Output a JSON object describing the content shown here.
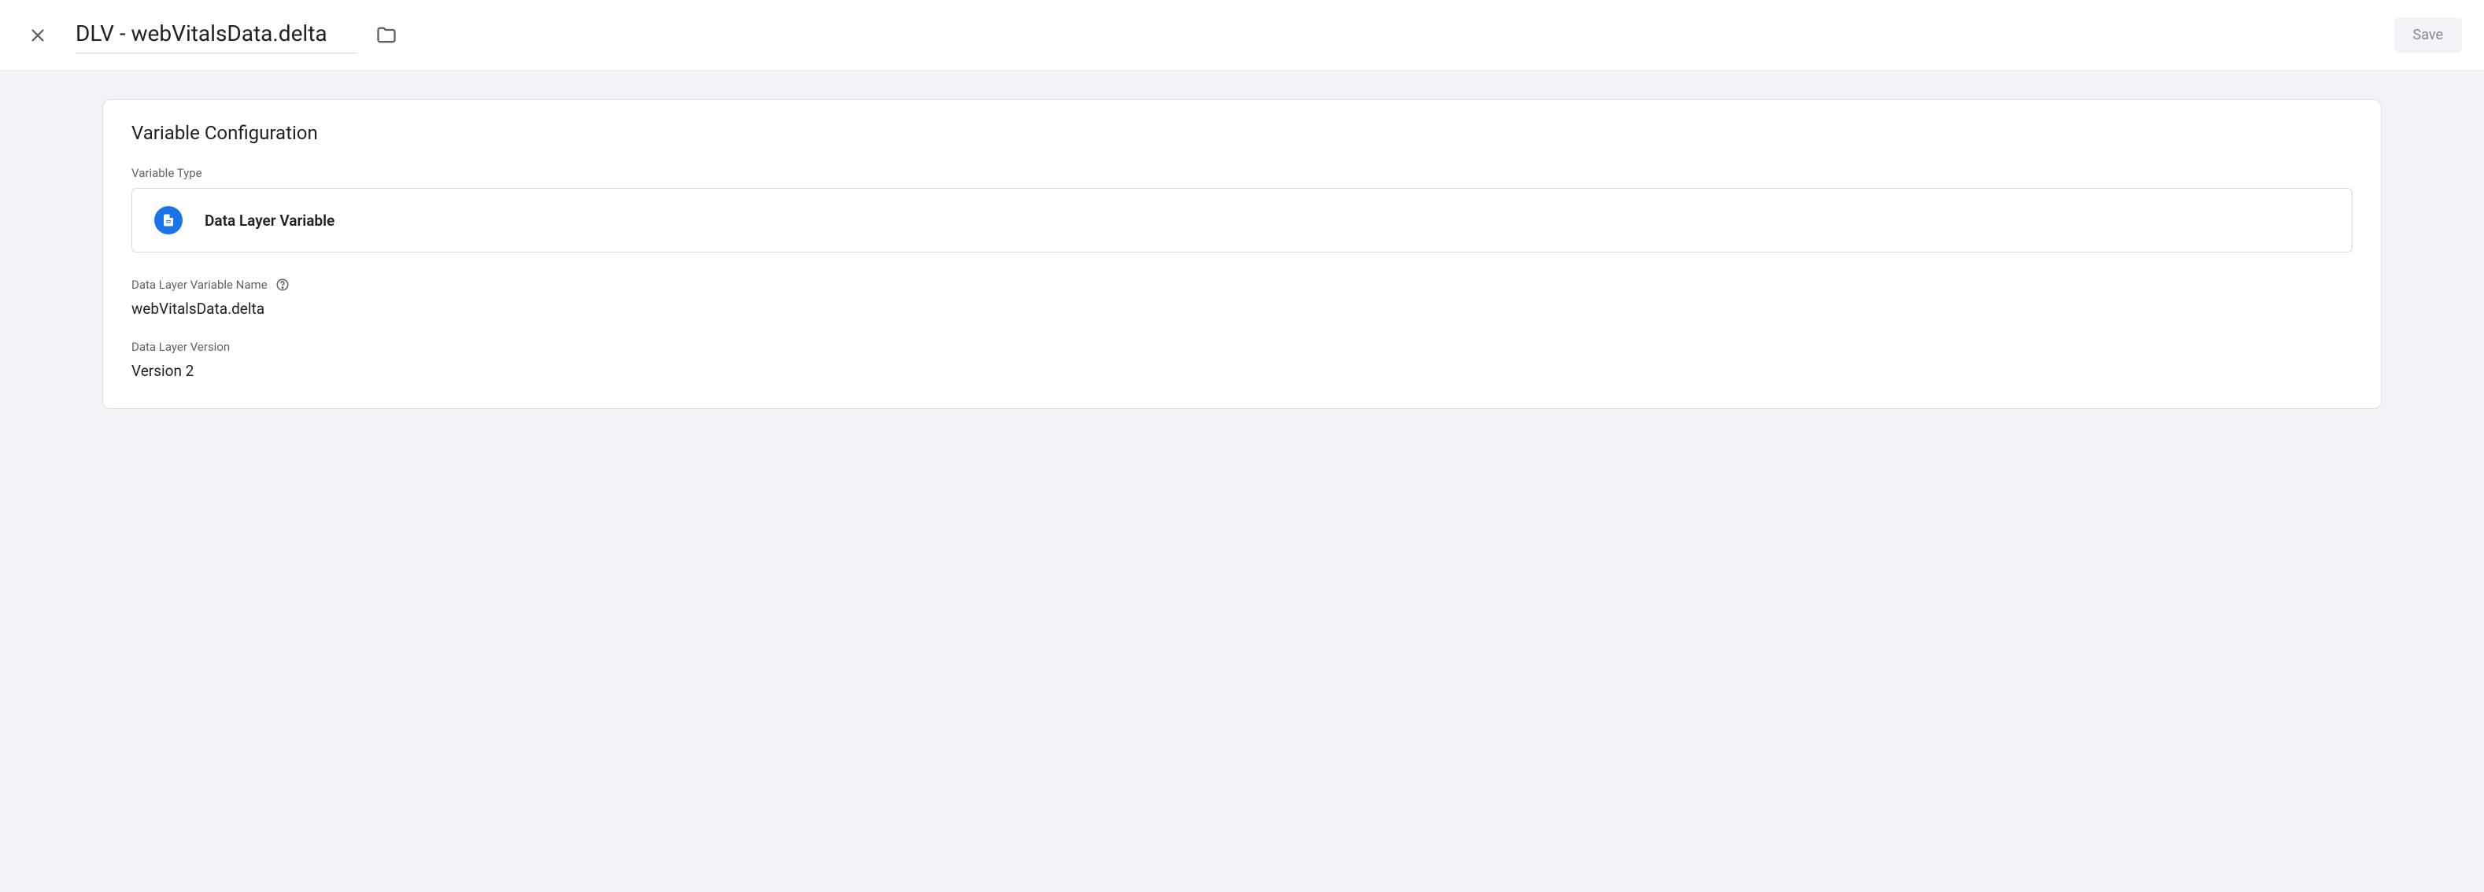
{
  "header": {
    "title": "DLV - webVitalsData.delta",
    "save_label": "Save"
  },
  "card": {
    "title": "Variable Configuration",
    "type_label": "Variable Type",
    "type_name": "Data Layer Variable",
    "name_label": "Data Layer Variable Name",
    "name_value": "webVitalsData.delta",
    "version_label": "Data Layer Version",
    "version_value": "Version 2"
  }
}
